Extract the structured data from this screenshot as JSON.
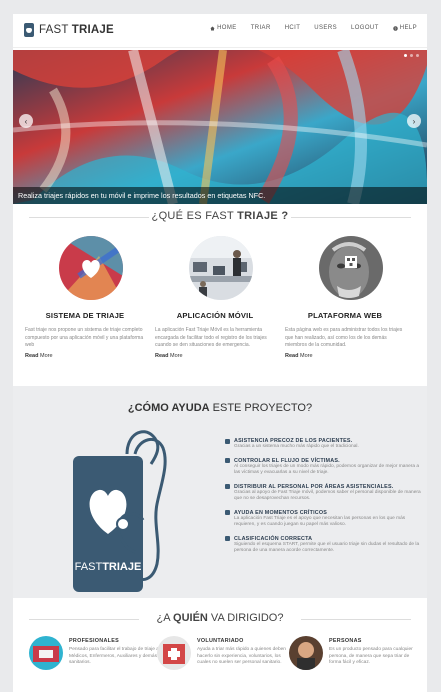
{
  "header": {
    "logo_light": "FAST ",
    "logo_bold": "TRIAJE",
    "nav": [
      {
        "label": "HOME",
        "icon": "home-icon"
      },
      {
        "label": "TRIAR",
        "icon": ""
      },
      {
        "label": "HCIT",
        "icon": ""
      },
      {
        "label": "USERS",
        "icon": ""
      },
      {
        "label": "LOGOUT",
        "icon": ""
      },
      {
        "label": "HELP",
        "icon": "help-icon"
      }
    ]
  },
  "slider": {
    "caption": "Realiza triajes rápidos en tu móvil e imprime los resultados en etiquetas NFC.",
    "prev": "‹",
    "next": "›"
  },
  "about": {
    "title_light": "¿QUÉ ES FAST ",
    "title_bold": "TRIAJE ?",
    "features": [
      {
        "title": "SISTEMA DE TRIAJE",
        "text": "Fast triaje nos propone un sistema de triaje completo compuesto por una aplicación móvil y una plataforma web",
        "more_bold": "Read",
        "more_light": " More"
      },
      {
        "title": "APLICACIÓN MÓVIL",
        "text": "La aplicación Fast Triaje Móvil es la herramienta encargada de facilitar todo el registro de los triajes cuando se den situaciones de emergencia.",
        "more_bold": "Read",
        "more_light": " More"
      },
      {
        "title": "PLATAFORMA WEB",
        "text": "Esta página web es para administrar todos los triajes que han realizado, así como los de los demás miembros de la comunidad.",
        "more_bold": "Read",
        "more_light": " More"
      }
    ]
  },
  "help": {
    "title_bold": "¿CÓMO AYUDA",
    "title_light": " ESTE PROYECTO?",
    "logo_light": "FAST",
    "logo_bold": "TRIAJE",
    "items": [
      {
        "head": "ASISTENCIA PRECOZ DE LOS PACIENTES.",
        "body": "Gracias a un sistema mucho más rápido que el tradicional."
      },
      {
        "head": "CONTROLAR EL FLUJO DE VÍCTIMAS.",
        "body": "Al conseguir los triajes de un modo más rápido, podemos organizar de mejor manera a las víctimas y evacuarlas a su nivel de triaje."
      },
      {
        "head": "DISTRIBUIR AL PERSONAL POR ÁREAS ASISTENCIALES.",
        "body": "Gracias al apoyo de Fast Triaje móvil, podemos saber el personal disponible de manera que no se desaprovechan recursos."
      },
      {
        "head": "AYUDA EN MOMENTOS CRÍTICOS",
        "body": "La aplicación Fast Triaje es el apoyo que necesitan las personas en los que más requieren, y es cuando juegan su papel más valioso."
      },
      {
        "head": "CLASIFICACIÓN CORRECTA",
        "body": "Siguiendo el esquema START, permite que el usuario triaje sin dudas el resultado de la persona de una manera acorde correctamente."
      }
    ]
  },
  "who": {
    "title_light": "¿A ",
    "title_bold": "QUIÉN",
    "title_light2": " VA DIRIGIDO?",
    "cards": [
      {
        "name": "PROFESIONALES",
        "text": "Pensado para facilitar el trabajo de triaje a Médicos, Enfermeros, Auxiliares y demás sanitarios."
      },
      {
        "name": "VOLUNTARIADO",
        "text": "Ayuda a triar más rápido a quienes deben hacerlo sin experiencia, voluntarios, los cuales no suelen ser personal sanitario."
      },
      {
        "name": "PERSONAS",
        "text": "Es un producto pensado para cualquier persona, de manera que sepa triar de forma fácil y eficaz."
      }
    ]
  },
  "colors": {
    "accent": "#3b5a73",
    "page_bg": "#e9eaec",
    "band_bg": "#ecedef"
  }
}
